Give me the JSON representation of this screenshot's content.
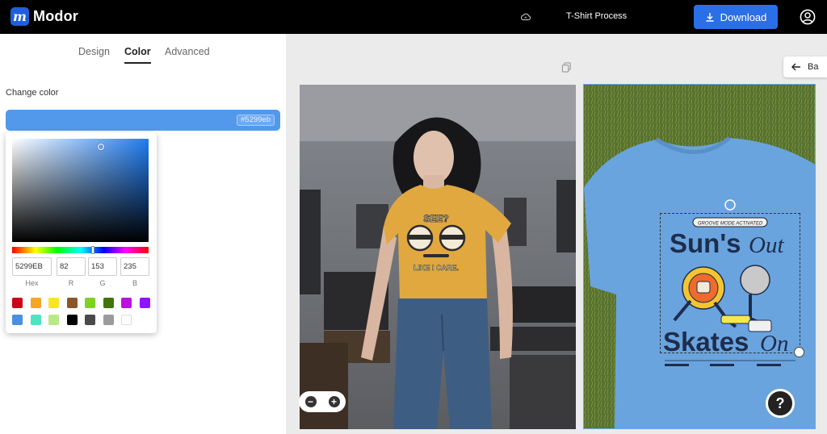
{
  "app": {
    "name": "Modor",
    "logo_letter": "m",
    "project_name": "T-Shirt Process"
  },
  "header": {
    "download_label": "Download"
  },
  "sidebar": {
    "tabs": [
      {
        "label": "Design"
      },
      {
        "label": "Color",
        "active": true
      },
      {
        "label": "Advanced"
      }
    ],
    "change_color_label": "Change color",
    "current_color": "#5299eb",
    "current_color_chip": "#5299eb"
  },
  "picker": {
    "hex_value": "5299EB",
    "r_value": "82",
    "g_value": "153",
    "b_value": "235",
    "labels": {
      "hex": "Hex",
      "r": "R",
      "g": "G",
      "b": "B"
    },
    "swatches_row1": [
      "#d0021b",
      "#f5a623",
      "#f8e71c",
      "#8b572a",
      "#7ed321",
      "#417505",
      "#bd10e0",
      "#9013fe"
    ],
    "swatches_row2": [
      "#4a90e2",
      "#50e3c2",
      "#b8e986",
      "#000000",
      "#4a4a4a",
      "#9b9b9b",
      "#ffffff"
    ]
  },
  "canvas": {
    "back_label": "Ba",
    "help_label": "?",
    "mockup1": {
      "shirt_color": "#e0a83f",
      "text_top": "SEE?",
      "text_bottom": "LIKE I CARE."
    },
    "mockup2": {
      "shirt_color": "#6aa4de",
      "tagline": "GROOVE MODE ACTIVATED",
      "line1a": "Sun's",
      "line1b": "Out",
      "line2a": "Skates",
      "line2b": "On"
    }
  }
}
